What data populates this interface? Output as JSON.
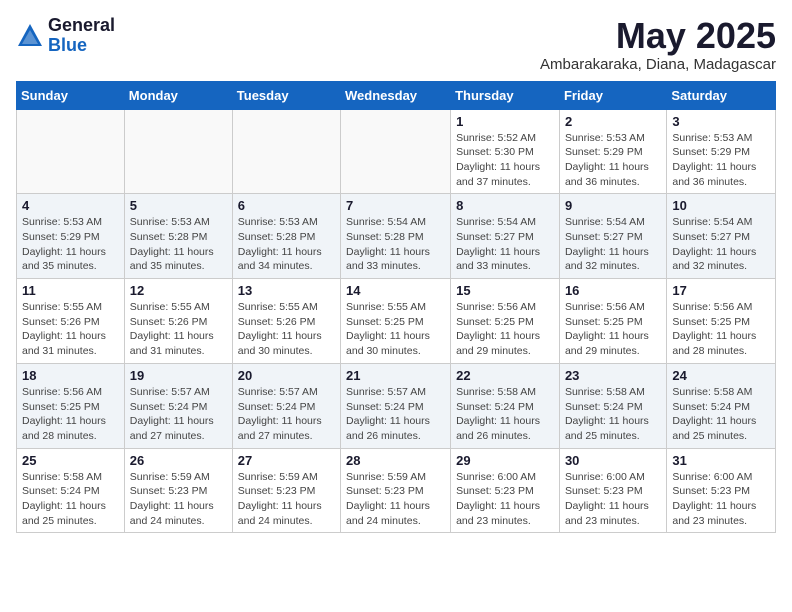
{
  "logo": {
    "general": "General",
    "blue": "Blue"
  },
  "title": "May 2025",
  "location": "Ambarakaraka, Diana, Madagascar",
  "days_header": [
    "Sunday",
    "Monday",
    "Tuesday",
    "Wednesday",
    "Thursday",
    "Friday",
    "Saturday"
  ],
  "weeks": [
    [
      {
        "day": "",
        "info": ""
      },
      {
        "day": "",
        "info": ""
      },
      {
        "day": "",
        "info": ""
      },
      {
        "day": "",
        "info": ""
      },
      {
        "day": "1",
        "info": "Sunrise: 5:52 AM\nSunset: 5:30 PM\nDaylight: 11 hours\nand 37 minutes."
      },
      {
        "day": "2",
        "info": "Sunrise: 5:53 AM\nSunset: 5:29 PM\nDaylight: 11 hours\nand 36 minutes."
      },
      {
        "day": "3",
        "info": "Sunrise: 5:53 AM\nSunset: 5:29 PM\nDaylight: 11 hours\nand 36 minutes."
      }
    ],
    [
      {
        "day": "4",
        "info": "Sunrise: 5:53 AM\nSunset: 5:29 PM\nDaylight: 11 hours\nand 35 minutes."
      },
      {
        "day": "5",
        "info": "Sunrise: 5:53 AM\nSunset: 5:28 PM\nDaylight: 11 hours\nand 35 minutes."
      },
      {
        "day": "6",
        "info": "Sunrise: 5:53 AM\nSunset: 5:28 PM\nDaylight: 11 hours\nand 34 minutes."
      },
      {
        "day": "7",
        "info": "Sunrise: 5:54 AM\nSunset: 5:28 PM\nDaylight: 11 hours\nand 33 minutes."
      },
      {
        "day": "8",
        "info": "Sunrise: 5:54 AM\nSunset: 5:27 PM\nDaylight: 11 hours\nand 33 minutes."
      },
      {
        "day": "9",
        "info": "Sunrise: 5:54 AM\nSunset: 5:27 PM\nDaylight: 11 hours\nand 32 minutes."
      },
      {
        "day": "10",
        "info": "Sunrise: 5:54 AM\nSunset: 5:27 PM\nDaylight: 11 hours\nand 32 minutes."
      }
    ],
    [
      {
        "day": "11",
        "info": "Sunrise: 5:55 AM\nSunset: 5:26 PM\nDaylight: 11 hours\nand 31 minutes."
      },
      {
        "day": "12",
        "info": "Sunrise: 5:55 AM\nSunset: 5:26 PM\nDaylight: 11 hours\nand 31 minutes."
      },
      {
        "day": "13",
        "info": "Sunrise: 5:55 AM\nSunset: 5:26 PM\nDaylight: 11 hours\nand 30 minutes."
      },
      {
        "day": "14",
        "info": "Sunrise: 5:55 AM\nSunset: 5:25 PM\nDaylight: 11 hours\nand 30 minutes."
      },
      {
        "day": "15",
        "info": "Sunrise: 5:56 AM\nSunset: 5:25 PM\nDaylight: 11 hours\nand 29 minutes."
      },
      {
        "day": "16",
        "info": "Sunrise: 5:56 AM\nSunset: 5:25 PM\nDaylight: 11 hours\nand 29 minutes."
      },
      {
        "day": "17",
        "info": "Sunrise: 5:56 AM\nSunset: 5:25 PM\nDaylight: 11 hours\nand 28 minutes."
      }
    ],
    [
      {
        "day": "18",
        "info": "Sunrise: 5:56 AM\nSunset: 5:25 PM\nDaylight: 11 hours\nand 28 minutes."
      },
      {
        "day": "19",
        "info": "Sunrise: 5:57 AM\nSunset: 5:24 PM\nDaylight: 11 hours\nand 27 minutes."
      },
      {
        "day": "20",
        "info": "Sunrise: 5:57 AM\nSunset: 5:24 PM\nDaylight: 11 hours\nand 27 minutes."
      },
      {
        "day": "21",
        "info": "Sunrise: 5:57 AM\nSunset: 5:24 PM\nDaylight: 11 hours\nand 26 minutes."
      },
      {
        "day": "22",
        "info": "Sunrise: 5:58 AM\nSunset: 5:24 PM\nDaylight: 11 hours\nand 26 minutes."
      },
      {
        "day": "23",
        "info": "Sunrise: 5:58 AM\nSunset: 5:24 PM\nDaylight: 11 hours\nand 25 minutes."
      },
      {
        "day": "24",
        "info": "Sunrise: 5:58 AM\nSunset: 5:24 PM\nDaylight: 11 hours\nand 25 minutes."
      }
    ],
    [
      {
        "day": "25",
        "info": "Sunrise: 5:58 AM\nSunset: 5:24 PM\nDaylight: 11 hours\nand 25 minutes."
      },
      {
        "day": "26",
        "info": "Sunrise: 5:59 AM\nSunset: 5:23 PM\nDaylight: 11 hours\nand 24 minutes."
      },
      {
        "day": "27",
        "info": "Sunrise: 5:59 AM\nSunset: 5:23 PM\nDaylight: 11 hours\nand 24 minutes."
      },
      {
        "day": "28",
        "info": "Sunrise: 5:59 AM\nSunset: 5:23 PM\nDaylight: 11 hours\nand 24 minutes."
      },
      {
        "day": "29",
        "info": "Sunrise: 6:00 AM\nSunset: 5:23 PM\nDaylight: 11 hours\nand 23 minutes."
      },
      {
        "day": "30",
        "info": "Sunrise: 6:00 AM\nSunset: 5:23 PM\nDaylight: 11 hours\nand 23 minutes."
      },
      {
        "day": "31",
        "info": "Sunrise: 6:00 AM\nSunset: 5:23 PM\nDaylight: 11 hours\nand 23 minutes."
      }
    ]
  ]
}
